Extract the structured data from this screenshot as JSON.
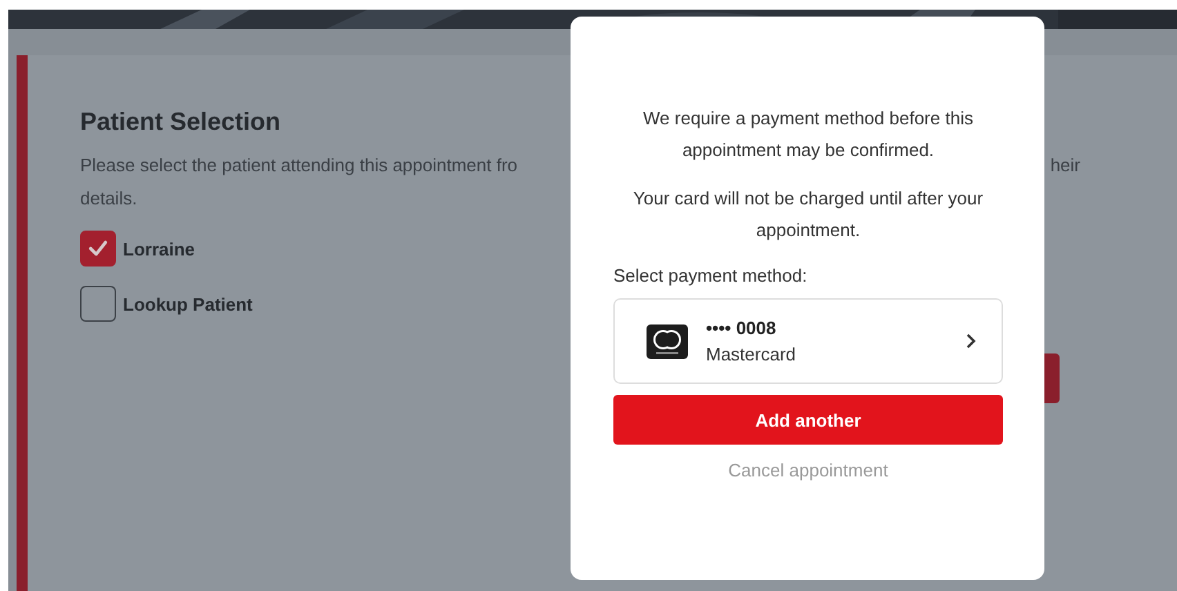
{
  "background": {
    "heading": "Patient Selection",
    "description_line1_left": "Please select the patient attending this appointment fro",
    "description_line1_right": "heir",
    "description_line2": "details.",
    "patients": [
      {
        "label": "Lorraine",
        "checked": true
      },
      {
        "label": "Lookup Patient",
        "checked": false
      }
    ]
  },
  "modal": {
    "messages": [
      "We require a payment method before this appointment may be confirmed.",
      "Your card will not be charged until after your appointment."
    ],
    "select_label": "Select payment method:",
    "payment_methods": [
      {
        "masked_number": "•••• 0008",
        "brand": "Mastercard"
      }
    ],
    "primary_button": "Add another",
    "cancel_link": "Cancel appointment"
  }
}
